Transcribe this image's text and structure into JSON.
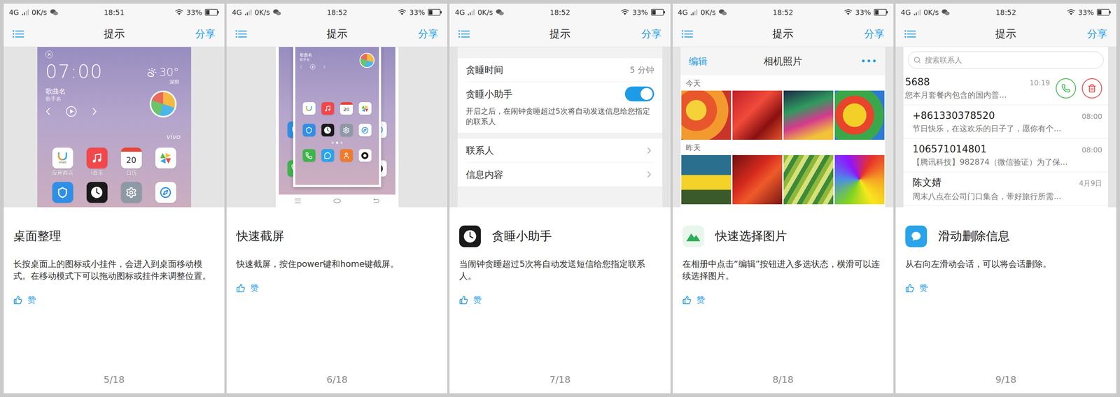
{
  "panels": [
    {
      "status": {
        "network": "4G",
        "speed": "0K/s",
        "time": "18:51",
        "battery": "33%",
        "battery_level": 0.33
      },
      "header": {
        "title": "提示",
        "action": "分享"
      },
      "preview": {
        "kind": "home",
        "clock": "07:00",
        "temperature": "30°",
        "city": "深圳",
        "song": "歌曲名",
        "artist": "歌手名",
        "watermark": "vivo",
        "apps": [
          {
            "label": "应用商店",
            "kind": "store",
            "color": "#ffffff",
            "glyph": "vivo"
          },
          {
            "label": "i音乐",
            "kind": "music",
            "color": "#f2474b"
          },
          {
            "label": "日历",
            "kind": "calendar",
            "color": "#ffffff",
            "glyph": "20"
          },
          {
            "kind": "gallery",
            "color": "#ffffff"
          },
          {
            "kind": "shield",
            "color": "#2f8fe6"
          },
          {
            "kind": "clock",
            "color": "#1a1a1a"
          },
          {
            "kind": "gear",
            "color": "#8e99a6"
          },
          {
            "kind": "browser",
            "color": "#ffffff"
          }
        ]
      },
      "card": {
        "title": "桌面整理",
        "description": "长按桌面上的图标或小挂件，会进入到桌面移动模式。在移动模式下可以拖动图标或挂件来调整位置。",
        "like": "赞"
      },
      "page": "5/18"
    },
    {
      "status": {
        "network": "4G",
        "speed": "0K/s",
        "time": "18:52",
        "battery": "33%",
        "battery_level": 0.33
      },
      "header": {
        "title": "提示",
        "action": "分享"
      },
      "preview": {
        "kind": "screenshot",
        "song": "歌曲名",
        "artist": "歌手名",
        "apps": [
          {
            "kind": "store",
            "color": "#ffffff"
          },
          {
            "kind": "music",
            "color": "#f2474b"
          },
          {
            "kind": "calendar",
            "color": "#ffffff",
            "glyph": "20"
          },
          {
            "kind": "gallery",
            "color": "#ffffff"
          },
          {
            "kind": "shield",
            "color": "#2f8fe6"
          },
          {
            "kind": "clock",
            "color": "#1a1a1a"
          },
          {
            "kind": "gear",
            "color": "#8e99a6"
          },
          {
            "kind": "browser",
            "color": "#ffffff"
          },
          {
            "kind": "phone",
            "color": "#3cb54a"
          },
          {
            "kind": "message",
            "color": "#2aa4ea"
          },
          {
            "kind": "contacts",
            "color": "#f07b2b"
          },
          {
            "kind": "camera",
            "color": "#ffffff"
          }
        ]
      },
      "card": {
        "title": "快速截屏",
        "description": "快速截屏，按住power键和home键截屏。",
        "like": "赞"
      },
      "page": "6/18"
    },
    {
      "status": {
        "network": "4G",
        "speed": "0K/s",
        "time": "18:52",
        "battery": "33%",
        "battery_level": 0.33
      },
      "header": {
        "title": "提示",
        "action": "分享"
      },
      "preview": {
        "kind": "settings",
        "rows": [
          {
            "label": "贪睡时间",
            "kind": "value",
            "value": "5 分钟"
          },
          {
            "label": "贪睡小助手",
            "kind": "toggle",
            "on": true,
            "note": "开启之后，在闹钟贪睡超过5次将自动发送信息给您指定的联系人"
          }
        ],
        "links": [
          {
            "label": "联系人"
          },
          {
            "label": "信息内容"
          }
        ]
      },
      "card": {
        "title": "贪睡小助手",
        "description": "当闹钟贪睡超过5次将自动发送短信给您指定联系人。",
        "like": "赞"
      },
      "page": "7/18"
    },
    {
      "status": {
        "network": "4G",
        "speed": "0K/s",
        "time": "18:52",
        "battery": "33%",
        "battery_level": 0.33
      },
      "header": {
        "title": "提示",
        "action": "分享"
      },
      "preview": {
        "kind": "gallery",
        "edit": "编辑",
        "title": "相机照片",
        "more": "•••",
        "sections": [
          {
            "label": "今天",
            "photos": 4
          },
          {
            "label": "昨天",
            "photos": 4
          }
        ]
      },
      "card": {
        "title": "快速选择图片",
        "description": "在相册中点击“编辑”按钮进入多选状态，横滑可以连续选择图片。",
        "like": "赞"
      },
      "page": "8/18"
    },
    {
      "status": {
        "network": "4G",
        "speed": "0K/s",
        "time": "18:52",
        "battery": "33%",
        "battery_level": 0.33
      },
      "header": {
        "title": "提示",
        "action": "分享"
      },
      "preview": {
        "kind": "messages",
        "search": "搜索联系人",
        "threads": [
          {
            "name": "5688",
            "time": "10:19",
            "snippet": "您本月套餐内包含的国内普...",
            "swiped": true
          },
          {
            "name": "+861330378520",
            "time": "08:00",
            "snippet": "节日快乐，在这欢乐的日子了，愿你有个...",
            "swiped": false
          },
          {
            "name": "106571014801",
            "time": "08:00",
            "snippet": "【腾讯科技】982874（微信验证）为了保...",
            "swiped": false
          },
          {
            "name": "陈文婧",
            "time": "4月9日",
            "snippet": "周末八点在公司门口集合，带好旅行所需...",
            "swiped": false
          }
        ]
      },
      "card": {
        "title": "滑动删除信息",
        "description": "从右向左滑动会话，可以将会话删除。",
        "like": "赞"
      },
      "page": "9/18"
    }
  ]
}
